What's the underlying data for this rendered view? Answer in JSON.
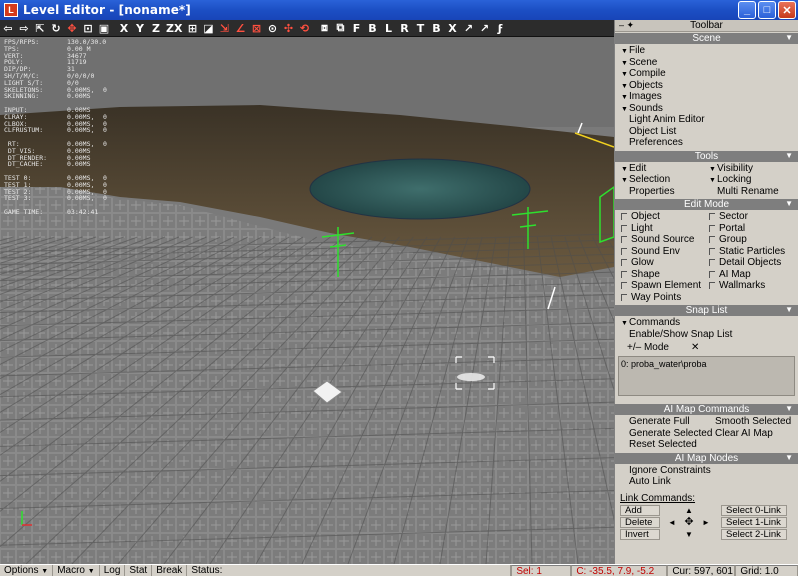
{
  "window": {
    "title": "Level Editor - [noname*]",
    "app_icon": "L",
    "minimize": "_",
    "maximize": "□",
    "close": "✕"
  },
  "top_toolbar": {
    "tools": [
      {
        "name": "arrow-left-icon",
        "glyph": "⇦",
        "color": "white"
      },
      {
        "name": "arrow-right-icon",
        "glyph": "⇨",
        "color": "white"
      },
      {
        "name": "select-icon",
        "glyph": "⇱",
        "color": "white"
      },
      {
        "name": "rotate-icon",
        "glyph": "↻",
        "color": "white"
      },
      {
        "name": "move-icon",
        "glyph": "✥",
        "color": "red"
      },
      {
        "name": "scale-icon",
        "glyph": "⊡",
        "color": "white"
      },
      {
        "name": "box-icon",
        "glyph": "▣",
        "color": "white"
      },
      {
        "name": "sep",
        "glyph": "",
        "color": "white"
      },
      {
        "name": "axis-x-button",
        "glyph": "X",
        "color": "white"
      },
      {
        "name": "axis-y-button",
        "glyph": "Y",
        "color": "white"
      },
      {
        "name": "axis-z-button",
        "glyph": "Z",
        "color": "white"
      },
      {
        "name": "axis-zx-button",
        "glyph": "ZX",
        "color": "white"
      },
      {
        "name": "snap-grid-icon",
        "glyph": "⊞",
        "color": "white"
      },
      {
        "name": "snap-object-icon",
        "glyph": "◪",
        "color": "white"
      },
      {
        "name": "snap-move-icon",
        "glyph": "⇲",
        "color": "red"
      },
      {
        "name": "snap-angle-icon",
        "glyph": "∠",
        "color": "red"
      },
      {
        "name": "snap-scale-icon",
        "glyph": "⊠",
        "color": "red"
      },
      {
        "name": "snap-vertex-icon",
        "glyph": "⊙",
        "color": "white"
      },
      {
        "name": "snap-normal-icon",
        "glyph": "✣",
        "color": "red"
      },
      {
        "name": "snap-rotate-icon",
        "glyph": "⟲",
        "color": "red"
      },
      {
        "name": "sep",
        "glyph": "",
        "color": "white"
      },
      {
        "name": "zoom-extents-icon",
        "glyph": "⧈",
        "color": "white"
      },
      {
        "name": "zoom-selected-icon",
        "glyph": "⧉",
        "color": "white"
      },
      {
        "name": "view-front-button",
        "glyph": "F",
        "color": "white"
      },
      {
        "name": "view-back-button",
        "glyph": "B",
        "color": "white"
      },
      {
        "name": "view-left-button",
        "glyph": "L",
        "color": "white"
      },
      {
        "name": "view-right-button",
        "glyph": "R",
        "color": "white"
      },
      {
        "name": "view-top-button",
        "glyph": "T",
        "color": "white"
      },
      {
        "name": "view-bottom-button",
        "glyph": "B",
        "color": "white"
      },
      {
        "name": "view-x-button",
        "glyph": "X",
        "color": "white"
      },
      {
        "name": "camera-planar-icon",
        "glyph": "↗",
        "color": "white"
      },
      {
        "name": "camera-free-icon",
        "glyph": "↗",
        "color": "white"
      },
      {
        "name": "camera-fly-icon",
        "glyph": "ϝ",
        "color": "white"
      }
    ]
  },
  "stats": [
    {
      "k": "FPS/RFPS:",
      "v": "130.0/30.0",
      "w": ""
    },
    {
      "k": "TPS:",
      "v": "0.00 M",
      "w": ""
    },
    {
      "k": "VERT:",
      "v": "34677",
      "w": ""
    },
    {
      "k": "POLY:",
      "v": "11719",
      "w": ""
    },
    {
      "k": "DIP/DP:",
      "v": "31",
      "w": ""
    },
    {
      "k": "SH/T/M/C:",
      "v": "0/0/0/0",
      "w": ""
    },
    {
      "k": "LIGHT S/T:",
      "v": "0/0",
      "w": ""
    },
    {
      "k": "SKELETONS:",
      "v": "0.00MS,",
      "w": "0"
    },
    {
      "k": "SKINNING:",
      "v": "0.00MS",
      "w": ""
    },
    {
      "k": "",
      "v": "",
      "w": ""
    },
    {
      "k": "INPUT:",
      "v": "0.00MS",
      "w": ""
    },
    {
      "k": "CLRAY:",
      "v": "0.00MS,",
      "w": "0"
    },
    {
      "k": "CLBOX:",
      "v": "0.00MS,",
      "w": "0"
    },
    {
      "k": "CLFRUSTUM:",
      "v": "0.00MS,",
      "w": "0"
    },
    {
      "k": "",
      "v": "",
      "w": ""
    },
    {
      "k": " RT:",
      "v": "0.00MS,",
      "w": "0"
    },
    {
      "k": " DT_VIS:",
      "v": "0.00MS",
      "w": ""
    },
    {
      "k": " DT_RENDER:",
      "v": "0.00MS",
      "w": ""
    },
    {
      "k": " DT_CACHE:",
      "v": "0.00MS",
      "w": ""
    },
    {
      "k": "",
      "v": "",
      "w": ""
    },
    {
      "k": "TEST 0:",
      "v": "0.00MS,",
      "w": "0"
    },
    {
      "k": "TEST 1:",
      "v": "0.00MS,",
      "w": "0"
    },
    {
      "k": "TEST 2:",
      "v": "0.00MS,",
      "w": "0"
    },
    {
      "k": "TEST 3:",
      "v": "0.00MS,",
      "w": "0"
    },
    {
      "k": "",
      "v": "",
      "w": ""
    },
    {
      "k": "GAME TIME:",
      "v": "03:42:41",
      "w": ""
    }
  ],
  "panel": {
    "header_pin": "– ✦",
    "header_title": "Toolbar",
    "scene": {
      "title": "Scene",
      "arrow": "▼",
      "menus": [
        "File",
        "Scene",
        "Compile",
        "Objects",
        "Images",
        "Sounds"
      ],
      "links": [
        "Light Anim Editor",
        "Object List",
        "Preferences"
      ]
    },
    "tools": {
      "title": "Tools",
      "arrow": "▼",
      "menus_left": [
        "Edit",
        "Selection"
      ],
      "menus_right": [
        "Visibility",
        "Locking"
      ],
      "properties": "Properties",
      "multi_rename": "Multi Rename"
    },
    "edit_mode": {
      "title": "Edit Mode",
      "arrow": "▼",
      "left": [
        "Object",
        "Light",
        "Sound Source",
        "Sound Env",
        "Glow",
        "Shape",
        "Spawn Element",
        "Way Points"
      ],
      "right": [
        "Sector",
        "Portal",
        "Group",
        "Static Particles",
        "Detail Objects",
        "AI Map",
        "Wallmarks"
      ]
    },
    "snap_list": {
      "title": "Snap List",
      "arrow": "▼",
      "commands": "Commands",
      "enable": "Enable/Show Snap List",
      "mode": "+/– Mode",
      "clear": "✕",
      "item": "0: proba_water\\proba"
    },
    "ai_cmds": {
      "title": "AI Map Commands",
      "arrow": "▼",
      "generate_full": "Generate Full",
      "smooth_selected": "Smooth Selected",
      "generate_selected": "Generate Selected",
      "clear_ai_map": "Clear AI Map",
      "reset_selected": "Reset Selected"
    },
    "ai_nodes": {
      "title": "AI Map Nodes",
      "arrow": "▼",
      "ignore_constraints": "Ignore Constraints",
      "auto_link": "Auto Link"
    },
    "link": {
      "label": "Link Commands:",
      "add": "Add",
      "delete": "Delete",
      "invert": "Invert",
      "select0": "Select 0-Link",
      "select1": "Select 1-Link",
      "select2": "Select 2-Link",
      "up": "▲",
      "left": "◄",
      "center": "✥",
      "right": "►",
      "down": "▼"
    }
  },
  "statusbar": {
    "options": "Options",
    "options_arrow": "▼",
    "macro": "Macro",
    "macro_arrow": "▼",
    "log": "Log",
    "stat": "Stat",
    "break": "Break",
    "status_label": "Status:",
    "sel": "Sel: 1",
    "coords": "C: -35.5, 7.9, -5.2",
    "cursor": "Cur: 597, 601",
    "grid": "Grid: 1.0"
  }
}
